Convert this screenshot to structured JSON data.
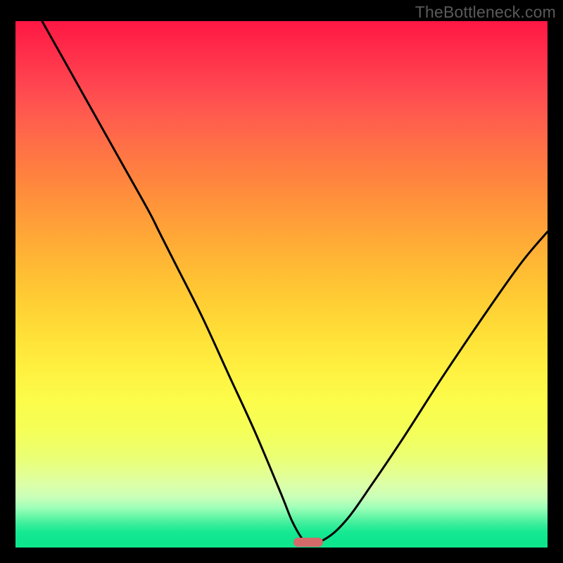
{
  "watermark": "TheBottleneck.com",
  "chart_data": {
    "type": "line",
    "title": "",
    "xlabel": "",
    "ylabel": "",
    "xlim": [
      0,
      100
    ],
    "ylim": [
      0,
      100
    ],
    "series": [
      {
        "name": "curve",
        "x": [
          5,
          10,
          15,
          20,
          25,
          27,
          30,
          35,
          40,
          45,
          50,
          52,
          54,
          55,
          58,
          62,
          67,
          73,
          80,
          88,
          95,
          100
        ],
        "y": [
          100,
          91,
          82,
          73,
          64,
          60,
          54,
          44,
          33,
          22,
          10,
          5,
          1.5,
          1,
          1.5,
          5,
          12,
          21,
          32,
          44,
          54,
          60
        ]
      }
    ],
    "marker": {
      "x": 55,
      "y": 1,
      "width_pct": 5.5,
      "height_pct": 1.8
    },
    "gradient_stops": [
      {
        "pos": 0,
        "color": "#ff1744"
      },
      {
        "pos": 50,
        "color": "#ffd034"
      },
      {
        "pos": 78,
        "color": "#f4ff58"
      },
      {
        "pos": 100,
        "color": "#0ee68e"
      }
    ]
  }
}
